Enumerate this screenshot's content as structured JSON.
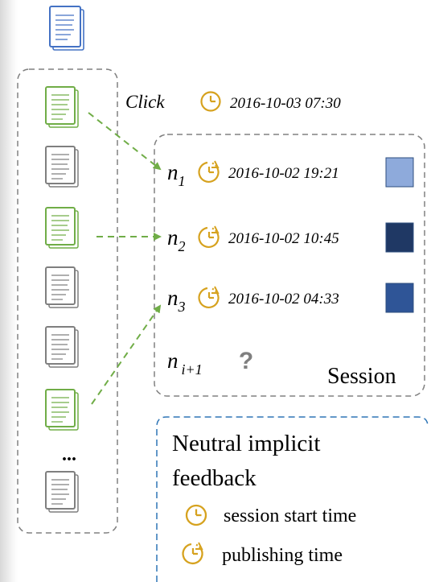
{
  "click_event": {
    "label": "Click",
    "time": "2016-10-03 07:30"
  },
  "session": {
    "label": "Session",
    "items": [
      {
        "base": "n",
        "sub": "1",
        "time": "2016-10-02 19:21",
        "color": "#8eaadb"
      },
      {
        "base": "n",
        "sub": "2",
        "time": "2016-10-02 10:45",
        "color": "#1f3864"
      },
      {
        "base": "n",
        "sub": "3",
        "time": "2016-10-02 04:33",
        "color": "#2f5597"
      }
    ],
    "next_item": {
      "base": "n",
      "sub": "i+1",
      "placeholder": "?"
    }
  },
  "article_list": {
    "ellipsis": "...",
    "docs": [
      {
        "state": "clicked"
      },
      {
        "state": "neutral"
      },
      {
        "state": "clicked"
      },
      {
        "state": "neutral"
      },
      {
        "state": "neutral"
      },
      {
        "state": "clicked"
      },
      {
        "state": "neutral"
      }
    ]
  },
  "legend": {
    "title_line1": "Neutral implicit",
    "title_line2": "feedback",
    "items": [
      {
        "icon": "clock-icon",
        "label": "session start time"
      },
      {
        "icon": "dashed-clock-icon",
        "label": "publishing time"
      }
    ]
  },
  "colors": {
    "target_doc": "#4472c4",
    "clicked_doc": "#70ad47",
    "neutral_doc": "#7f7f7f",
    "clock": "#d6a21f",
    "arrow": "#70ad47",
    "dashed_border": "#808080",
    "legend_border": "#2e75b6"
  }
}
